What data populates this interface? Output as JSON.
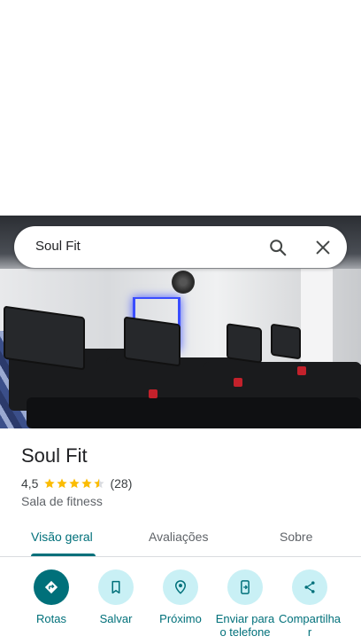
{
  "search": {
    "query": "Soul Fit"
  },
  "place": {
    "name": "Soul Fit",
    "rating": "4,5",
    "stars": 4.5,
    "review_count": "(28)",
    "category": "Sala de fitness"
  },
  "tabs": [
    {
      "label": "Visão geral"
    },
    {
      "label": "Avaliações"
    },
    {
      "label": "Sobre"
    }
  ],
  "actions": [
    {
      "label": "Rotas",
      "icon": "directions-icon"
    },
    {
      "label": "Salvar",
      "icon": "bookmark-icon"
    },
    {
      "label": "Próximo",
      "icon": "nearby-icon"
    },
    {
      "label": "Enviar para o telefone",
      "icon": "send-to-phone-icon"
    },
    {
      "label": "Compartilhar",
      "icon": "share-icon"
    }
  ],
  "colors": {
    "accent": "#00707a",
    "action_bg": "#c9f0f5",
    "star": "#fbbc04"
  }
}
